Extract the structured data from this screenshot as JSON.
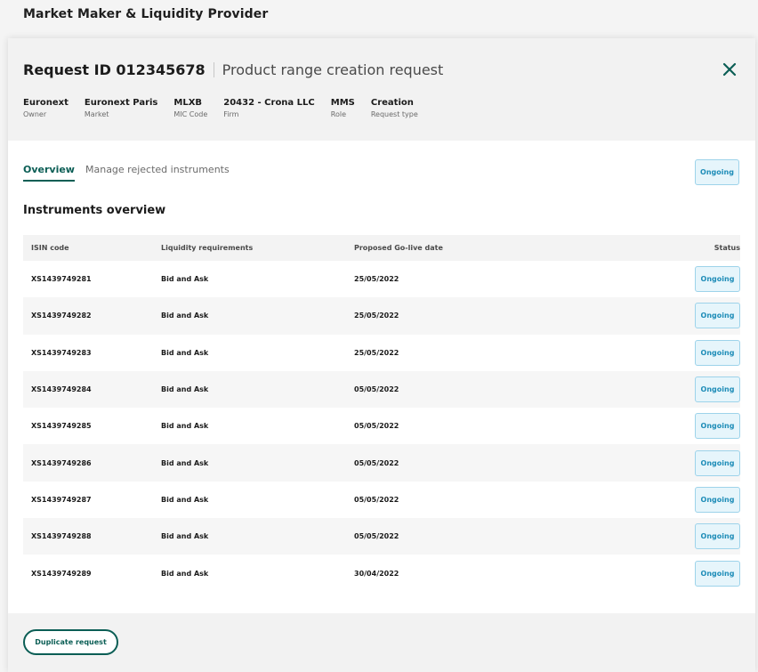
{
  "app": {
    "title": "Market Maker & Liquidity Provider"
  },
  "request": {
    "id_label": "Request ID 012345678",
    "description": "Product range creation request",
    "meta": [
      {
        "value": "Euronext",
        "label": "Owner"
      },
      {
        "value": "Euronext Paris",
        "label": "Market"
      },
      {
        "value": "MLXB",
        "label": "MIC Code"
      },
      {
        "value": "20432 - Crona LLC",
        "label": "Firm"
      },
      {
        "value": "MMS",
        "label": "Role"
      },
      {
        "value": "Creation",
        "label": "Request type"
      }
    ]
  },
  "tabs": [
    {
      "label": "Overview",
      "active": true
    },
    {
      "label": "Manage rejected instruments",
      "active": false
    }
  ],
  "header_status": "Ongoing",
  "section_title": "Instruments overview",
  "table": {
    "headers": {
      "isin": "ISIN code",
      "liquidity": "Liquidity requirements",
      "golive": "Proposed Go-live date",
      "status": "Status"
    },
    "rows": [
      {
        "isin": "XS1439749281",
        "liquidity": "Bid and Ask",
        "golive": "25/05/2022",
        "status": "Ongoing"
      },
      {
        "isin": "XS1439749282",
        "liquidity": "Bid and Ask",
        "golive": "25/05/2022",
        "status": "Ongoing"
      },
      {
        "isin": "XS1439749283",
        "liquidity": "Bid and Ask",
        "golive": "25/05/2022",
        "status": "Ongoing"
      },
      {
        "isin": "XS1439749284",
        "liquidity": "Bid and Ask",
        "golive": "05/05/2022",
        "status": "Ongoing"
      },
      {
        "isin": "XS1439749285",
        "liquidity": "Bid and Ask",
        "golive": "05/05/2022",
        "status": "Ongoing"
      },
      {
        "isin": "XS1439749286",
        "liquidity": "Bid and Ask",
        "golive": "05/05/2022",
        "status": "Ongoing"
      },
      {
        "isin": "XS1439749287",
        "liquidity": "Bid and Ask",
        "golive": "05/05/2022",
        "status": "Ongoing"
      },
      {
        "isin": "XS1439749288",
        "liquidity": "Bid and Ask",
        "golive": "05/05/2022",
        "status": "Ongoing"
      },
      {
        "isin": "XS1439749289",
        "liquidity": "Bid and Ask",
        "golive": "30/04/2022",
        "status": "Ongoing"
      }
    ]
  },
  "footer": {
    "duplicate_label": "Duplicate request"
  },
  "icons": {
    "close": "close-icon"
  },
  "colors": {
    "accent": "#0b5e55",
    "status_text": "#1f8db8",
    "status_bg": "#e6f5fb",
    "status_border": "#9dd3ea"
  }
}
